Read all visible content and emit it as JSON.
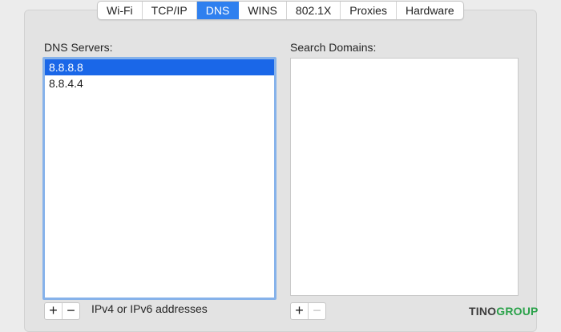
{
  "tabs": [
    {
      "label": "Wi-Fi",
      "selected": false
    },
    {
      "label": "TCP/IP",
      "selected": false
    },
    {
      "label": "DNS",
      "selected": true
    },
    {
      "label": "WINS",
      "selected": false
    },
    {
      "label": "802.1X",
      "selected": false
    },
    {
      "label": "Proxies",
      "selected": false
    },
    {
      "label": "Hardware",
      "selected": false
    }
  ],
  "dns_servers": {
    "label": "DNS Servers:",
    "items": [
      {
        "value": "8.8.8.8",
        "selected": true
      },
      {
        "value": "8.8.4.4",
        "selected": false
      }
    ],
    "add_label": "+",
    "remove_label": "−",
    "hint": "IPv4 or IPv6 addresses"
  },
  "search_domains": {
    "label": "Search Domains:",
    "items": [],
    "add_label": "+",
    "remove_label": "−"
  },
  "watermark": {
    "part1": "TINO",
    "part2": "GROUP"
  },
  "colors": {
    "accent": "#2f80ef",
    "selection": "#1a67e8",
    "focus_ring": "#86b2ea",
    "logo_green": "#2aa24a"
  }
}
